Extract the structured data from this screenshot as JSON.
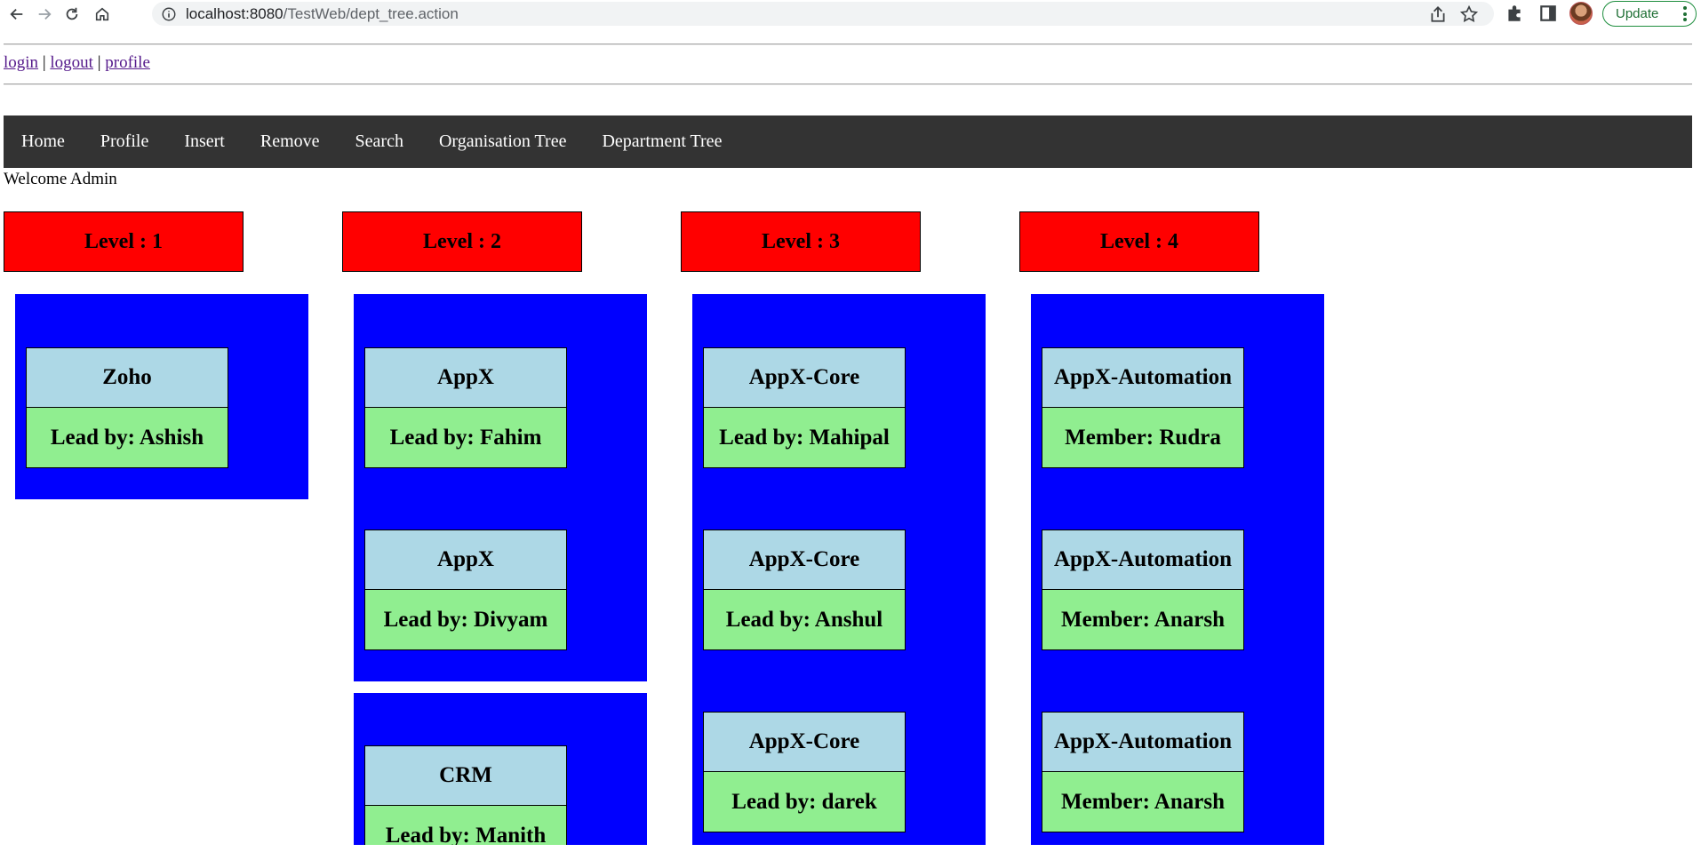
{
  "browser": {
    "url_host": "localhost:8080",
    "url_path": "/TestWeb/dept_tree.action",
    "update_label": "Update"
  },
  "auth": {
    "login": "login",
    "logout": "logout",
    "profile": "profile",
    "separator": "|"
  },
  "nav": [
    "Home",
    "Profile",
    "Insert",
    "Remove",
    "Search",
    "Organisation Tree",
    "Department Tree"
  ],
  "welcome": "Welcome Admin",
  "levels": [
    {
      "title": "Level : 1",
      "groups": [
        [
          {
            "name": "Zoho",
            "lead": "Lead by: Ashish"
          }
        ]
      ]
    },
    {
      "title": "Level : 2",
      "groups": [
        [
          {
            "name": "AppX",
            "lead": "Lead by: Fahim"
          },
          {
            "name": "AppX",
            "lead": "Lead by: Divyam"
          }
        ],
        [
          {
            "name": "CRM",
            "lead": "Lead by: Manith"
          }
        ]
      ]
    },
    {
      "title": "Level : 3",
      "groups": [
        [
          {
            "name": "AppX-Core",
            "lead": "Lead by: Mahipal"
          },
          {
            "name": "AppX-Core",
            "lead": "Lead by: Anshul"
          },
          {
            "name": "AppX-Core",
            "lead": "Lead by: darek"
          }
        ]
      ]
    },
    {
      "title": "Level : 4",
      "groups": [
        [
          {
            "name": "AppX-Automation",
            "lead": "Member: Rudra"
          },
          {
            "name": "AppX-Automation",
            "lead": "Member: Anarsh"
          },
          {
            "name": "AppX-Automation",
            "lead": "Member: Anarsh"
          }
        ]
      ]
    }
  ],
  "colors": {
    "level_header": "#ff0000",
    "group_box": "#0000ff",
    "dept_name": "#add8e6",
    "dept_lead": "#90ee90",
    "navbar": "#333333"
  }
}
